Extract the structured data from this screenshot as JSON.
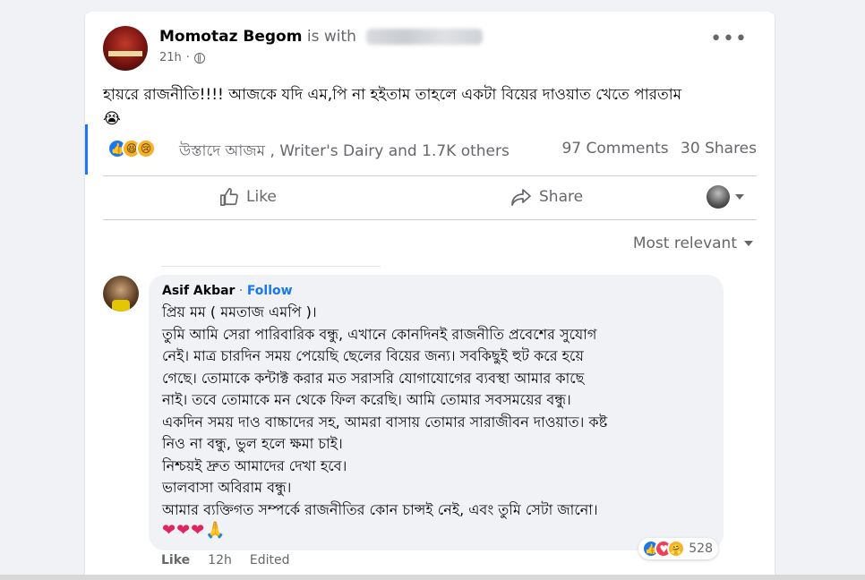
{
  "post": {
    "author": "Momotaz Begom",
    "with_text": "is with",
    "time": "21h",
    "more_label": "•••",
    "text": "হায়রে রাজনীতি!!!! আজকে যদি এম,পি না হইতাম তাহলে একটা বিয়ের দাওয়াত খেতে পারতাম",
    "emoji": "😭",
    "reaction_icons": [
      "like-icon",
      "haha-icon",
      "sad-icon"
    ],
    "reaction_names": "উস্তাদে আজম , Writer's Dairy and 1.7K others",
    "comments_count": "97 Comments",
    "shares_count": "30 Shares"
  },
  "actions": {
    "like_label": "Like",
    "share_label": "Share"
  },
  "sort": {
    "label": "Most relevant"
  },
  "comment": {
    "author": "Asif Akbar",
    "separator": "·",
    "follow_label": "Follow",
    "lines": [
      "প্রিয় মম ( মমতাজ এমপি )।",
      "তুমি আমি সেরা পারিবারিক বন্ধু, এখানে কোনদিনই রাজনীতি প্রবেশের সুযোগ",
      "নেই। মাত্র চারদিন সময় পেয়েছি ছেলের বিয়ের জন্য। সবকিছুই হুট করে হয়ে",
      "গেছে। তোমাকে কন্টাক্ট করার মত সরাসরি যোগাযোগের ব্যবস্থা আমার কাছে",
      "নাই। তবে তোমাকে মন থেকে ফিল করেছি। আমি তোমার সবসময়ের বন্ধু।",
      "একদিন সময় দাও বাচ্চাদের সহ, আমরা বাসায় তোমার সারাজীবন দাওয়াত। কষ্ট",
      "নিও না বন্ধু, ভুল হলে ক্ষমা চাই।",
      "নিশ্চয়ই দ্রুত আমাদের দেখা হবে।",
      "ভালবাসা অবিরাম বন্ধু।",
      "আমার ব্যক্তিগত সম্পর্কে রাজনীতির কোন চান্সই নেই, এবং তুমি সেটা জানো।"
    ],
    "hearts": "❤❤❤",
    "pray": "🙏",
    "reaction_icons": [
      "like-icon",
      "love-icon",
      "care-icon"
    ],
    "reaction_count": "528",
    "footer": {
      "like_label": "Like",
      "time": "12h",
      "edited": "Edited"
    }
  },
  "colors": {
    "accent": "#1877f2",
    "secondary_text": "#65676b",
    "background": "#f0f2f5"
  }
}
